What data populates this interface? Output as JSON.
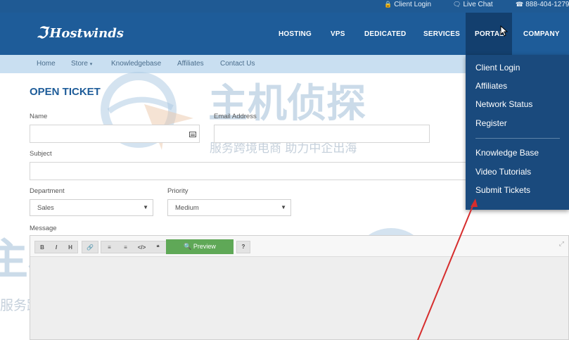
{
  "topbar": {
    "client_login": "Client Login",
    "live_chat": "Live Chat",
    "phone": "888-404-1279"
  },
  "header": {
    "logo": "Hostwinds",
    "nav": [
      "HOSTING",
      "VPS",
      "DEDICATED",
      "SERVICES",
      "PORTAL",
      "COMPANY"
    ]
  },
  "subnav": {
    "items": [
      "Home",
      "Store",
      "Knowledgebase",
      "Affiliates",
      "Contact Us"
    ]
  },
  "form": {
    "title": "OPEN TICKET",
    "name_label": "Name",
    "email_label": "Email Address",
    "subject_label": "Subject",
    "department_label": "Department",
    "department_value": "Sales",
    "priority_label": "Priority",
    "priority_value": "Medium",
    "message_label": "Message",
    "preview_label": "Preview",
    "toolbar": [
      "B",
      "I",
      "H",
      "link",
      "ul",
      "ol",
      "code",
      "quote"
    ]
  },
  "portal_menu": {
    "items": [
      "Client Login",
      "Affiliates",
      "Network Status",
      "Register",
      "Knowledge Base",
      "Video Tutorials",
      "Submit Tickets"
    ]
  },
  "watermark": {
    "main": "主机侦探",
    "sub": "服务跨境电商 助力中企出海"
  },
  "colors": {
    "header": "#1e5c99",
    "portal_menu": "#1a4a7d",
    "subnav": "#c9dff1",
    "title": "#1e5c99",
    "preview_button": "#5fa857",
    "annotation_arrow": "#d62d2d"
  }
}
